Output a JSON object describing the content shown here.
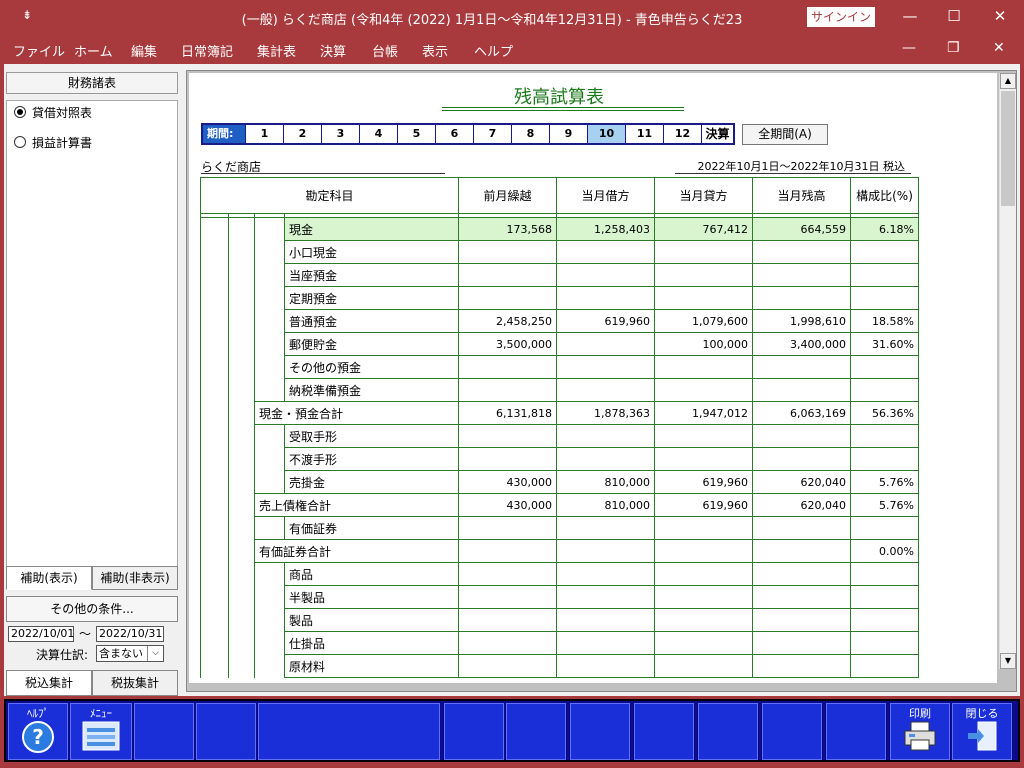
{
  "titlebar": {
    "sysmenu": "⇟",
    "title": "(一般) らくだ商店 (令和4年 (2022) 1月1日～令和4年12月31日)  -  青色申告らくだ23",
    "signin": "サインイン"
  },
  "menu": [
    "ファイル",
    "ホーム",
    "編集",
    "日常簿記",
    "集計表",
    "決算",
    "台帳",
    "表示",
    "ヘルプ"
  ],
  "left": {
    "header": "財務諸表",
    "radios": [
      {
        "label": "貸借対照表",
        "selected": true
      },
      {
        "label": "損益計算書",
        "selected": false
      }
    ],
    "tabs": [
      "補助(表示)",
      "補助(非表示)"
    ],
    "other_conditions": "その他の条件...",
    "date_from": "2022/10/01",
    "tilde": "～",
    "date_to": "2022/10/31",
    "kessan_label": "決算仕訳:",
    "kessan_value": "含まない",
    "tax_tabs": [
      "税込集計",
      "税抜集計"
    ]
  },
  "report": {
    "title": "残高試算表",
    "period_label": "期間:",
    "periods": [
      "1",
      "2",
      "3",
      "4",
      "5",
      "6",
      "7",
      "8",
      "9",
      "10",
      "11",
      "12",
      "決算"
    ],
    "selected_period": "10",
    "all_period_btn": "全期間(A)",
    "company": "らくだ商店",
    "date_range": "2022年10月1日～2022年10月31日  税込",
    "headers": [
      "勘定科目",
      "前月繰越",
      "当月借方",
      "当月貸方",
      "当月残高",
      "構成比(%)"
    ],
    "rows": [
      {
        "name": "現金",
        "level": 3,
        "prev": "173,568",
        "debit": "1,258,403",
        "credit": "767,412",
        "balance": "664,559",
        "ratio": "6.18%",
        "hl": true
      },
      {
        "name": "小口現金",
        "level": 3,
        "prev": "",
        "debit": "",
        "credit": "",
        "balance": "",
        "ratio": ""
      },
      {
        "name": "当座預金",
        "level": 3,
        "prev": "",
        "debit": "",
        "credit": "",
        "balance": "",
        "ratio": ""
      },
      {
        "name": "定期預金",
        "level": 3,
        "prev": "",
        "debit": "",
        "credit": "",
        "balance": "",
        "ratio": ""
      },
      {
        "name": "普通預金",
        "level": 3,
        "prev": "2,458,250",
        "debit": "619,960",
        "credit": "1,079,600",
        "balance": "1,998,610",
        "ratio": "18.58%"
      },
      {
        "name": "郵便貯金",
        "level": 3,
        "prev": "3,500,000",
        "debit": "",
        "credit": "100,000",
        "balance": "3,400,000",
        "ratio": "31.60%"
      },
      {
        "name": "その他の預金",
        "level": 3,
        "prev": "",
        "debit": "",
        "credit": "",
        "balance": "",
        "ratio": ""
      },
      {
        "name": "納税準備預金",
        "level": 3,
        "prev": "",
        "debit": "",
        "credit": "",
        "balance": "",
        "ratio": ""
      },
      {
        "name": "現金・預金合計",
        "level": 2,
        "prev": "6,131,818",
        "debit": "1,878,363",
        "credit": "1,947,012",
        "balance": "6,063,169",
        "ratio": "56.36%"
      },
      {
        "name": "受取手形",
        "level": 3,
        "prev": "",
        "debit": "",
        "credit": "",
        "balance": "",
        "ratio": ""
      },
      {
        "name": "不渡手形",
        "level": 3,
        "prev": "",
        "debit": "",
        "credit": "",
        "balance": "",
        "ratio": ""
      },
      {
        "name": "売掛金",
        "level": 3,
        "prev": "430,000",
        "debit": "810,000",
        "credit": "619,960",
        "balance": "620,040",
        "ratio": "5.76%"
      },
      {
        "name": "売上債権合計",
        "level": 2,
        "prev": "430,000",
        "debit": "810,000",
        "credit": "619,960",
        "balance": "620,040",
        "ratio": "5.76%"
      },
      {
        "name": "有価証券",
        "level": 3,
        "prev": "",
        "debit": "",
        "credit": "",
        "balance": "",
        "ratio": ""
      },
      {
        "name": "有価証券合計",
        "level": 2,
        "prev": "",
        "debit": "",
        "credit": "",
        "balance": "",
        "ratio": "0.00%"
      },
      {
        "name": "商品",
        "level": 3,
        "prev": "",
        "debit": "",
        "credit": "",
        "balance": "",
        "ratio": ""
      },
      {
        "name": "半製品",
        "level": 3,
        "prev": "",
        "debit": "",
        "credit": "",
        "balance": "",
        "ratio": ""
      },
      {
        "name": "製品",
        "level": 3,
        "prev": "",
        "debit": "",
        "credit": "",
        "balance": "",
        "ratio": ""
      },
      {
        "name": "仕掛品",
        "level": 3,
        "prev": "",
        "debit": "",
        "credit": "",
        "balance": "",
        "ratio": ""
      },
      {
        "name": "原材料",
        "level": 3,
        "prev": "",
        "debit": "",
        "credit": "",
        "balance": "",
        "ratio": ""
      }
    ]
  },
  "fkeys": [
    {
      "label": "ﾍﾙﾌﾟ",
      "icon": "help-icon"
    },
    {
      "label": "ﾒﾆｭｰ",
      "icon": "menu-icon"
    },
    {
      "label": "",
      "icon": ""
    },
    {
      "label": "",
      "icon": ""
    },
    {
      "label": "",
      "icon": ""
    },
    {
      "label": "",
      "icon": ""
    },
    {
      "label": "",
      "icon": ""
    },
    {
      "label": "",
      "icon": ""
    },
    {
      "label": "",
      "icon": ""
    },
    {
      "label": "",
      "icon": ""
    },
    {
      "label": "",
      "icon": ""
    },
    {
      "label": "",
      "icon": ""
    },
    {
      "label": "",
      "icon": ""
    },
    {
      "label": "印刷",
      "icon": "print-icon"
    },
    {
      "label": "閉じる",
      "icon": "close-door-icon"
    }
  ],
  "colors": {
    "accent": "#a83a3e",
    "grid": "#2a7a2a",
    "highlight": "#d8f5d0",
    "fbar": "#1a2fd8"
  }
}
